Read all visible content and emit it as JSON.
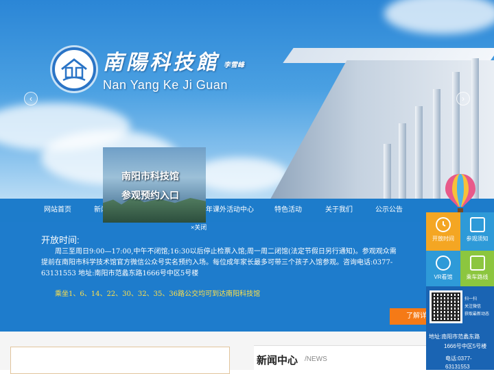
{
  "brand": {
    "name_cn": "南陽科技館",
    "calligrapher_mark": "李雪峰",
    "name_en": "Nan Yang Ke Ji Guan"
  },
  "nav": {
    "items": [
      "网站首页",
      "新闻",
      "年课外活动中心",
      "特色活动",
      "关于我们",
      "公示公告"
    ]
  },
  "popup": {
    "line1": "南阳市科技馆",
    "line2": "参观预约入口",
    "close": "×关闭"
  },
  "info": {
    "title": "开放时间:",
    "body": "周三至周日9:00—17:00,中午不闭馆;16:30以后停止检票入馆;周一周二闭馆(法定节假日另行通知)。参观观众需提前在南阳市科学技术馆官方微信公众号实名预约入场。每位成年家长最多可带三个孩子入馆参观。咨询电话:0377-63131553 地址:南阳市范蠡东路1666号中区5号楼",
    "bus": "乘坐1、6、14、22、30、32、35、36路公交均可到达南阳科技馆",
    "more": "了解详"
  },
  "news": {
    "title": "新闻中心",
    "subtitle": "/NEWS"
  },
  "float_panel": {
    "tiles": [
      {
        "label": "开放时间",
        "icon": "clock-icon",
        "color": "#f4a623"
      },
      {
        "label": "参观须知",
        "icon": "clipboard-icon",
        "color": "#2e9ad8"
      },
      {
        "label": "VR看馆",
        "icon": "vr-icon",
        "color": "#2e9ad8"
      },
      {
        "label": "乘车路线",
        "icon": "bus-icon",
        "color": "#8cc63f"
      }
    ],
    "qr_lines": [
      "扫一扫",
      "关注微信",
      "获取最新动态"
    ],
    "address_1": "地址:南阳市范蠡东路",
    "address_2": "1666号中区5号楼",
    "phone": "电话:0377-63131553"
  }
}
